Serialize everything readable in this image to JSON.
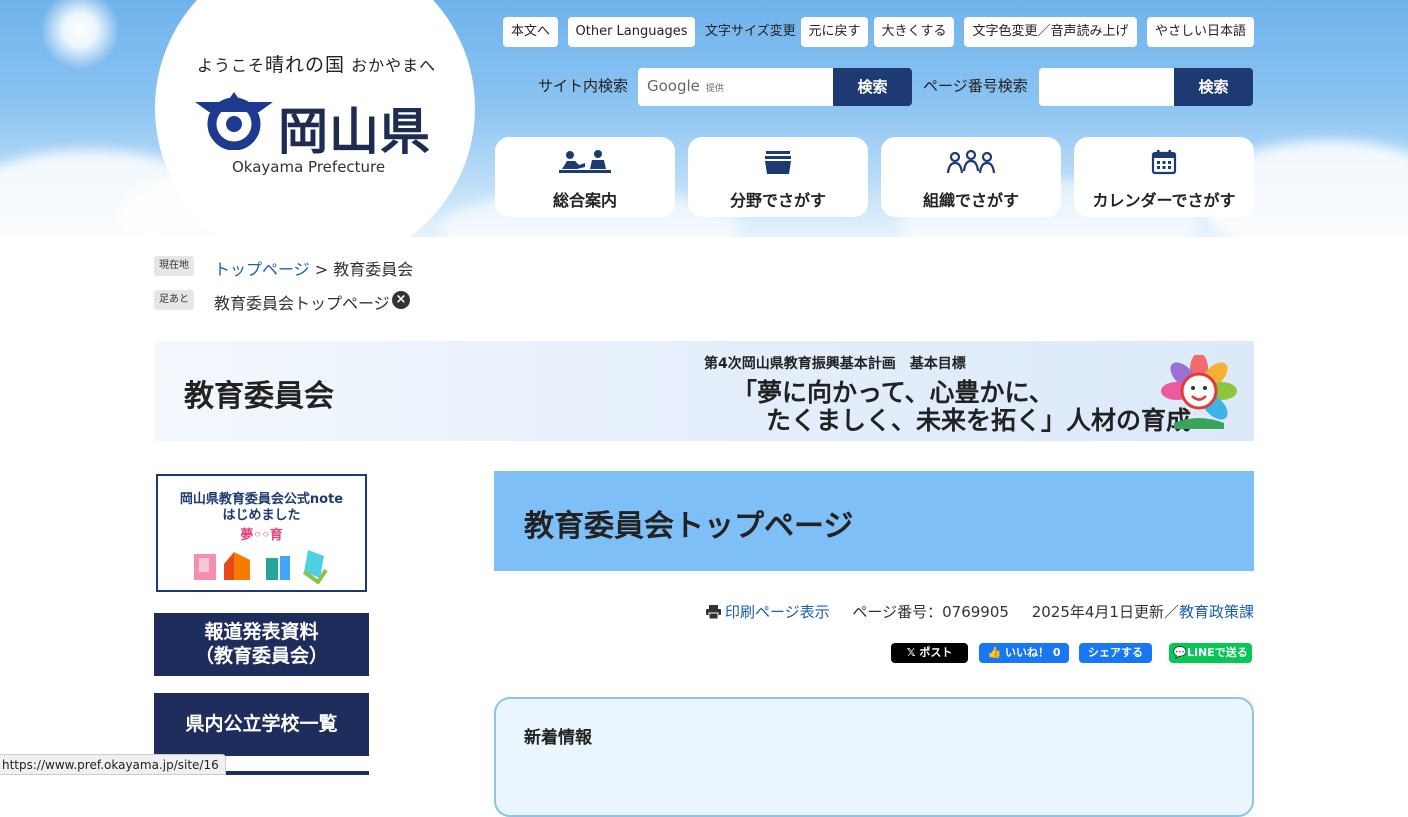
{
  "header": {
    "welcome_pre": "ようこそ",
    "welcome_big": "晴れの国",
    "welcome_post": "おかやまへ",
    "pref_name": "岡山県",
    "pref_name_en": "Okayama Prefecture",
    "utility": {
      "skip": "本文へ",
      "languages": "Other Languages",
      "font_size_label": "文字サイズ変更",
      "reset": "元に戻す",
      "larger": "大きくする",
      "color_voice": "文字色変更／音声読み上げ",
      "easy_japanese": "やさしい日本語"
    },
    "site_search_label": "サイト内検索",
    "google_label": "Google",
    "google_sub": "提供",
    "search_button": "検索",
    "page_search_label": "ページ番号検索",
    "page_search_button": "検索",
    "nav": [
      {
        "label": "総合案内",
        "icon": "reception-icon"
      },
      {
        "label": "分野でさがす",
        "icon": "tray-icon"
      },
      {
        "label": "組織でさがす",
        "icon": "people-icon"
      },
      {
        "label": "カレンダーでさがす",
        "icon": "calendar-icon"
      }
    ]
  },
  "breadcrumb": {
    "current_tag": "現在地",
    "top_link": "トップページ",
    "separator": " > ",
    "current": "教育委員会",
    "history_tag": "足あと",
    "history_item": "教育委員会トップページ"
  },
  "banner": {
    "title": "教育委員会",
    "subtitle": "第4次岡山県教育振興基本計画　基本目標",
    "line1": "「夢に向かって、心豊かに、",
    "line2": "たくましく、未来を拓く」人材の育成"
  },
  "sidebar": {
    "note_line1": "岡山県教育委員会公式note",
    "note_line2": "はじめました",
    "note_logo": "夢◦◦育",
    "buttons": [
      {
        "line1": "報道発表資料",
        "line2": "（教育委員会）"
      },
      {
        "line1": "県内公立学校一覧",
        "line2": ""
      }
    ]
  },
  "main": {
    "page_title": "教育委員会トップページ",
    "print_link": "印刷ページ表示",
    "page_number": "ページ番号：0769905",
    "updated": "2025年4月1日更新／",
    "department_link": "教育政策課",
    "share": {
      "x": "𝕏 ポスト",
      "like": "いいね！ 0",
      "fb_share": "シェアする",
      "line": "LINEで送る"
    },
    "news_title": "新着情報"
  },
  "status_bar": {
    "url": "https://www.pref.okayama.jp/site/16"
  },
  "colors": {
    "navy": "#1e3a72",
    "title_bg": "#7fbff7",
    "link": "#1a5fb4",
    "line_green": "#06c755",
    "fb_blue": "#1877f2"
  }
}
